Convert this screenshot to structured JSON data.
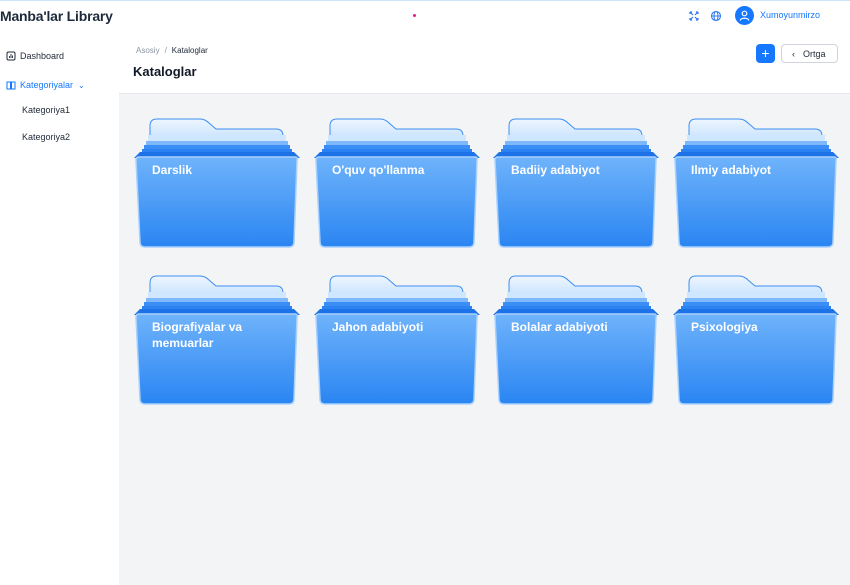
{
  "app": {
    "logo_text": "Manba'lar Library"
  },
  "topbar": {
    "username": "Xumoyunmirzo",
    "icons": [
      "fullscreen-icon",
      "globe-icon",
      "user-icon"
    ]
  },
  "sidebar": {
    "items": [
      {
        "label": "Dashboard",
        "icon": "dashboard-icon"
      },
      {
        "label": "Kategoriyalar",
        "icon": "book-icon",
        "active": true
      },
      {
        "label": "Kategoriya1"
      },
      {
        "label": "Kategoriya2"
      }
    ]
  },
  "header": {
    "breadcrumb": [
      "Asosiy",
      "Kataloglar"
    ],
    "title": "Kataloglar",
    "add_label": "+",
    "back_label": "Ortga"
  },
  "catalogs": [
    {
      "label": "Darslik"
    },
    {
      "label": "O'quv qo'llanma"
    },
    {
      "label": "Badiiy adabiyot"
    },
    {
      "label": "Ilmiy adabiyot"
    },
    {
      "label": "Biografiyalar va memuarlar"
    },
    {
      "label": "Jahon adabiyoti"
    },
    {
      "label": "Bolalar adabiyoti"
    },
    {
      "label": "Psixologiya"
    }
  ],
  "colors": {
    "accent": "#1677ff",
    "folder_top": "#4a9cf7",
    "folder_bottom": "#1f7ef0"
  }
}
